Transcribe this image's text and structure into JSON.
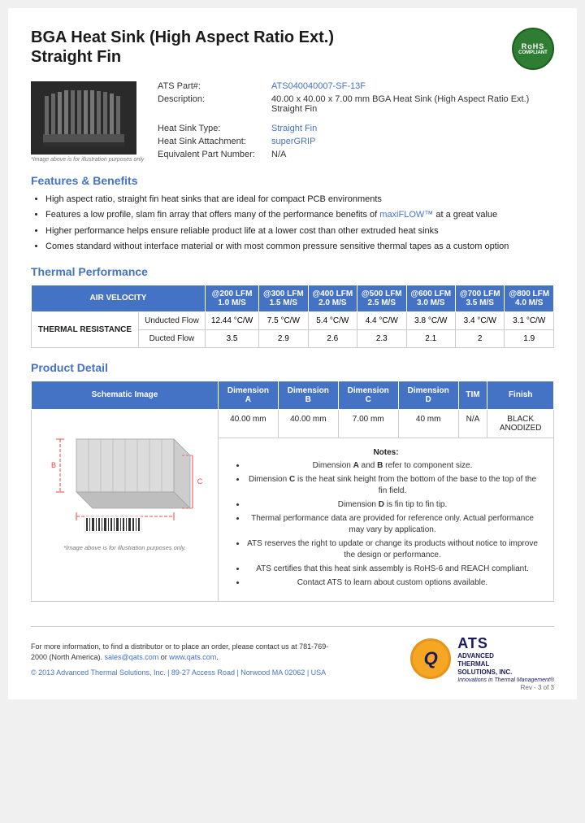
{
  "header": {
    "title_line1": "BGA Heat Sink (High Aspect Ratio Ext.)",
    "title_line2": "Straight Fin",
    "rohs_label": "RoHS",
    "rohs_compliant": "COMPLIANT"
  },
  "product_info": {
    "part_label": "ATS Part#:",
    "part_number": "ATS040040007-SF-13F",
    "desc_label": "Description:",
    "description": "40.00 x 40.00 x 7.00 mm  BGA Heat Sink (High Aspect Ratio Ext.) Straight Fin",
    "type_label": "Heat Sink Type:",
    "type_value": "Straight Fin",
    "attachment_label": "Heat Sink Attachment:",
    "attachment_value": "superGRIP",
    "equiv_label": "Equivalent Part Number:",
    "equiv_value": "N/A",
    "image_note": "*Image above is for illustration purposes only"
  },
  "features": {
    "heading": "Features & Benefits",
    "items": [
      "High aspect ratio, straight fin heat sinks that are ideal for compact PCB environments",
      "Features a low profile, slam fin array that offers many of the performance benefits of maxiFLOW™ at a great value",
      "Higher performance helps ensure reliable product life at a lower cost than other extruded heat sinks",
      "Comes standard without interface material or with most common pressure sensitive thermal tapes as a custom option"
    ],
    "maxiflow_link": "maxiFLOW™"
  },
  "thermal_performance": {
    "heading": "Thermal Performance",
    "table": {
      "air_velocity_label": "AIR VELOCITY",
      "columns": [
        {
          "lfm": "@200 LFM",
          "ms": "1.0 M/S"
        },
        {
          "lfm": "@300 LFM",
          "ms": "1.5 M/S"
        },
        {
          "lfm": "@400 LFM",
          "ms": "2.0 M/S"
        },
        {
          "lfm": "@500 LFM",
          "ms": "2.5 M/S"
        },
        {
          "lfm": "@600 LFM",
          "ms": "3.0 M/S"
        },
        {
          "lfm": "@700 LFM",
          "ms": "3.5 M/S"
        },
        {
          "lfm": "@800 LFM",
          "ms": "4.0 M/S"
        }
      ],
      "thermal_resistance_label": "THERMAL RESISTANCE",
      "unducted_label": "Unducted Flow",
      "ducted_label": "Ducted Flow",
      "unducted_values": [
        "12.44 °C/W",
        "7.5 °C/W",
        "5.4 °C/W",
        "4.4 °C/W",
        "3.8 °C/W",
        "3.4 °C/W",
        "3.1 °C/W"
      ],
      "ducted_values": [
        "3.5",
        "2.9",
        "2.6",
        "2.3",
        "2.1",
        "2",
        "1.9"
      ]
    }
  },
  "product_detail": {
    "heading": "Product Detail",
    "table_headers": [
      "Schematic Image",
      "Dimension A",
      "Dimension B",
      "Dimension C",
      "Dimension D",
      "TIM",
      "Finish"
    ],
    "dim_a": "40.00 mm",
    "dim_b": "40.00 mm",
    "dim_c": "7.00 mm",
    "dim_d": "40 mm",
    "tim": "N/A",
    "finish": "BLACK ANODIZED",
    "schematic_note": "*Image above is for illustration purposes only.",
    "notes_title": "Notes:",
    "notes": [
      "Dimension A and B refer to component size.",
      "Dimension C is the heat sink height from the bottom of the base to the top of the fin field.",
      "Dimension D is fin tip to fin tip.",
      "Thermal performance data are provided for reference only. Actual performance may vary by application.",
      "ATS reserves the right to update or change its products without notice to improve the design or performance.",
      "ATS certifies that this heat sink assembly is RoHS-6 and REACH compliant.",
      "Contact ATS to learn about custom options available."
    ]
  },
  "footer": {
    "contact_text": "For more information, to find a distributor or to place an order, please contact us at 781-769-2000 (North America).",
    "email": "sales@qats.com",
    "website": "www.qats.com",
    "copyright": "© 2013 Advanced Thermal Solutions, Inc.  |  89-27 Access Road  |  Norwood MA  02062  |  USA",
    "ats_letter": "Q",
    "ats_name": "ATS",
    "ats_fullname_line1": "ADVANCED",
    "ats_fullname_line2": "THERMAL",
    "ats_fullname_line3": "SOLUTIONS, INC.",
    "ats_tagline": "Innovations in Thermal Management®",
    "page_number": "Rev - 3 of 3"
  }
}
